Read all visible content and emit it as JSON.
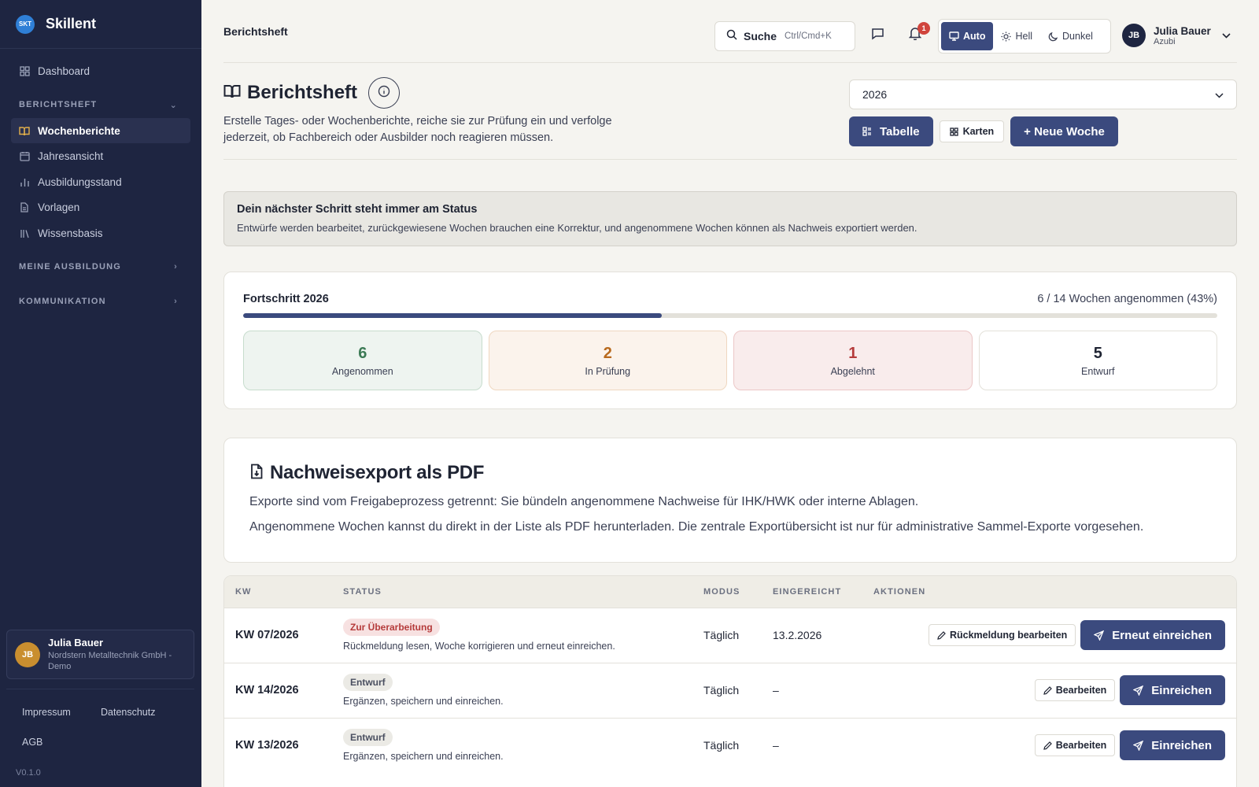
{
  "app": {
    "logo_text": "SKT",
    "name": "Skillent"
  },
  "sidebar": {
    "dashboard": "Dashboard",
    "section_report": "BERICHTSHEFT",
    "items": [
      {
        "label": "Wochenberichte",
        "icon": "book-icon",
        "active": true
      },
      {
        "label": "Jahresansicht",
        "icon": "calendar-icon"
      },
      {
        "label": "Ausbildungsstand",
        "icon": "bar-chart-icon"
      },
      {
        "label": "Vorlagen",
        "icon": "file-icon"
      },
      {
        "label": "Wissensbasis",
        "icon": "library-icon"
      }
    ],
    "section_training": "MEINE AUSBILDUNG",
    "section_comm": "KOMMUNIKATION",
    "user": {
      "initials": "JB",
      "name": "Julia Bauer",
      "company": "Nordstern Metalltechnik GmbH - Demo"
    },
    "links": [
      "Impressum",
      "Datenschutz",
      "AGB"
    ],
    "version": "V0.1.0"
  },
  "topbar": {
    "breadcrumb": "Berichtsheft",
    "search_label": "Suche",
    "search_shortcut": "Ctrl/Cmd+K",
    "notification_count": "1",
    "theme": {
      "auto": "Auto",
      "light": "Hell",
      "dark": "Dunkel",
      "selected": "Auto"
    },
    "user": {
      "initials": "JB",
      "name": "Julia Bauer",
      "role": "Azubi"
    }
  },
  "page": {
    "title": "Berichtsheft",
    "description": "Erstelle Tages- oder Wochenberichte, reiche sie zur Prüfung ein und verfolge jederzeit, ob Fachbereich oder Ausbilder noch reagieren müssen.",
    "year": "2026",
    "view_table": "Tabelle",
    "view_cards": "Karten",
    "new_week": "+ Neue Woche"
  },
  "notice": {
    "title": "Dein nächster Schritt steht immer am Status",
    "text": "Entwürfe werden bearbeitet, zurückgewiesene Wochen brauchen eine Korrektur, und angenommene Wochen können als Nachweis exportiert werden."
  },
  "progress": {
    "title": "Fortschritt 2026",
    "summary": "6 / 14 Wochen angenommen (43%)",
    "fraction": 0.43,
    "stats": [
      {
        "value": "6",
        "label": "Angenommen",
        "tone": "green"
      },
      {
        "value": "2",
        "label": "In Prüfung",
        "tone": "orange"
      },
      {
        "value": "1",
        "label": "Abgelehnt",
        "tone": "red"
      },
      {
        "value": "5",
        "label": "Entwurf",
        "tone": "white"
      }
    ]
  },
  "export": {
    "title": "Nachweisexport als PDF",
    "p1": "Exporte sind vom Freigabeprozess getrennt: Sie bündeln angenommene Nachweise für IHK/HWK oder interne Ablagen.",
    "p2": "Angenommene Wochen kannst du direkt in der Liste als PDF herunterladen. Die zentrale Exportübersicht ist nur für administrative Sammel-Exporte vorgesehen."
  },
  "table": {
    "headers": {
      "kw": "KW",
      "status": "STATUS",
      "mode": "MODUS",
      "submitted": "EINGEREICHT",
      "actions": "AKTIONEN"
    },
    "rows": [
      {
        "kw": "KW 07/2026",
        "status": "Zur Überarbeitung",
        "tone": "red",
        "hint": "Rückmeldung lesen, Woche korrigieren und erneut einreichen.",
        "mode": "Täglich",
        "submitted": "13.2.2026",
        "edit": "Rückmeldung bearbeiten",
        "send": "Erneut einreichen"
      },
      {
        "kw": "KW 14/2026",
        "status": "Entwurf",
        "tone": "gray",
        "hint": "Ergänzen, speichern und einreichen.",
        "mode": "Täglich",
        "submitted": "–",
        "edit": "Bearbeiten",
        "send": "Einreichen"
      },
      {
        "kw": "KW 13/2026",
        "status": "Entwurf",
        "tone": "gray",
        "hint": "Ergänzen, speichern und einreichen.",
        "mode": "Täglich",
        "submitted": "–",
        "edit": "Bearbeiten",
        "send": "Einreichen"
      }
    ]
  }
}
